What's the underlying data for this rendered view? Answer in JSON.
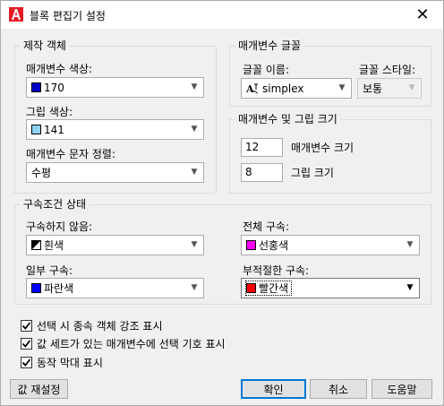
{
  "window": {
    "title": "블록 편집기 설정",
    "close_glyph": "✕"
  },
  "sections": {
    "create_objects": {
      "title": "제작 객체",
      "param_color_label": "매개변수 색상:",
      "param_color_value": "170",
      "param_color_swatch": "#0000c8",
      "grip_color_label": "그립 색상:",
      "grip_color_value": "141",
      "grip_color_swatch": "#8fd3f0",
      "param_text_align_label": "매개변수 문자 정렬:",
      "param_text_align_value": "수평"
    },
    "param_font": {
      "title": "매개변수 글꼴",
      "font_name_label": "글꼴 이름:",
      "font_name_value": "simplex",
      "font_style_label": "글꼴 스타일:",
      "font_style_value": "보통"
    },
    "param_grip_size": {
      "title": "매개변수 및 그립 크기",
      "param_size_value": "12",
      "param_size_label": "매개변수 크기",
      "grip_size_value": "8",
      "grip_size_label": "그립 크기"
    },
    "constraint_status": {
      "title": "구속조건 상태",
      "unconstrained_label": "구속하지 않음:",
      "unconstrained_value": "흰색",
      "fully_constrained_label": "전체 구속:",
      "fully_constrained_value": "선홍색",
      "fully_constrained_swatch": "#ff00ff",
      "partial_label": "일부 구속:",
      "partial_value": "파란색",
      "partial_swatch": "#0000ff",
      "improper_label": "부적절한 구속:",
      "improper_value": "빨간색",
      "improper_swatch": "#ff0000"
    }
  },
  "checkboxes": [
    {
      "label": "선택 시 종속 객체 강조 표시",
      "checked": true
    },
    {
      "label": "값 세트가 있는 매개변수에 선택 기호 표시",
      "checked": true
    },
    {
      "label": "동작 막대 표시",
      "checked": true
    }
  ],
  "buttons": {
    "reset": "값 재설정",
    "ok": "확인",
    "cancel": "취소",
    "help": "도움말"
  }
}
